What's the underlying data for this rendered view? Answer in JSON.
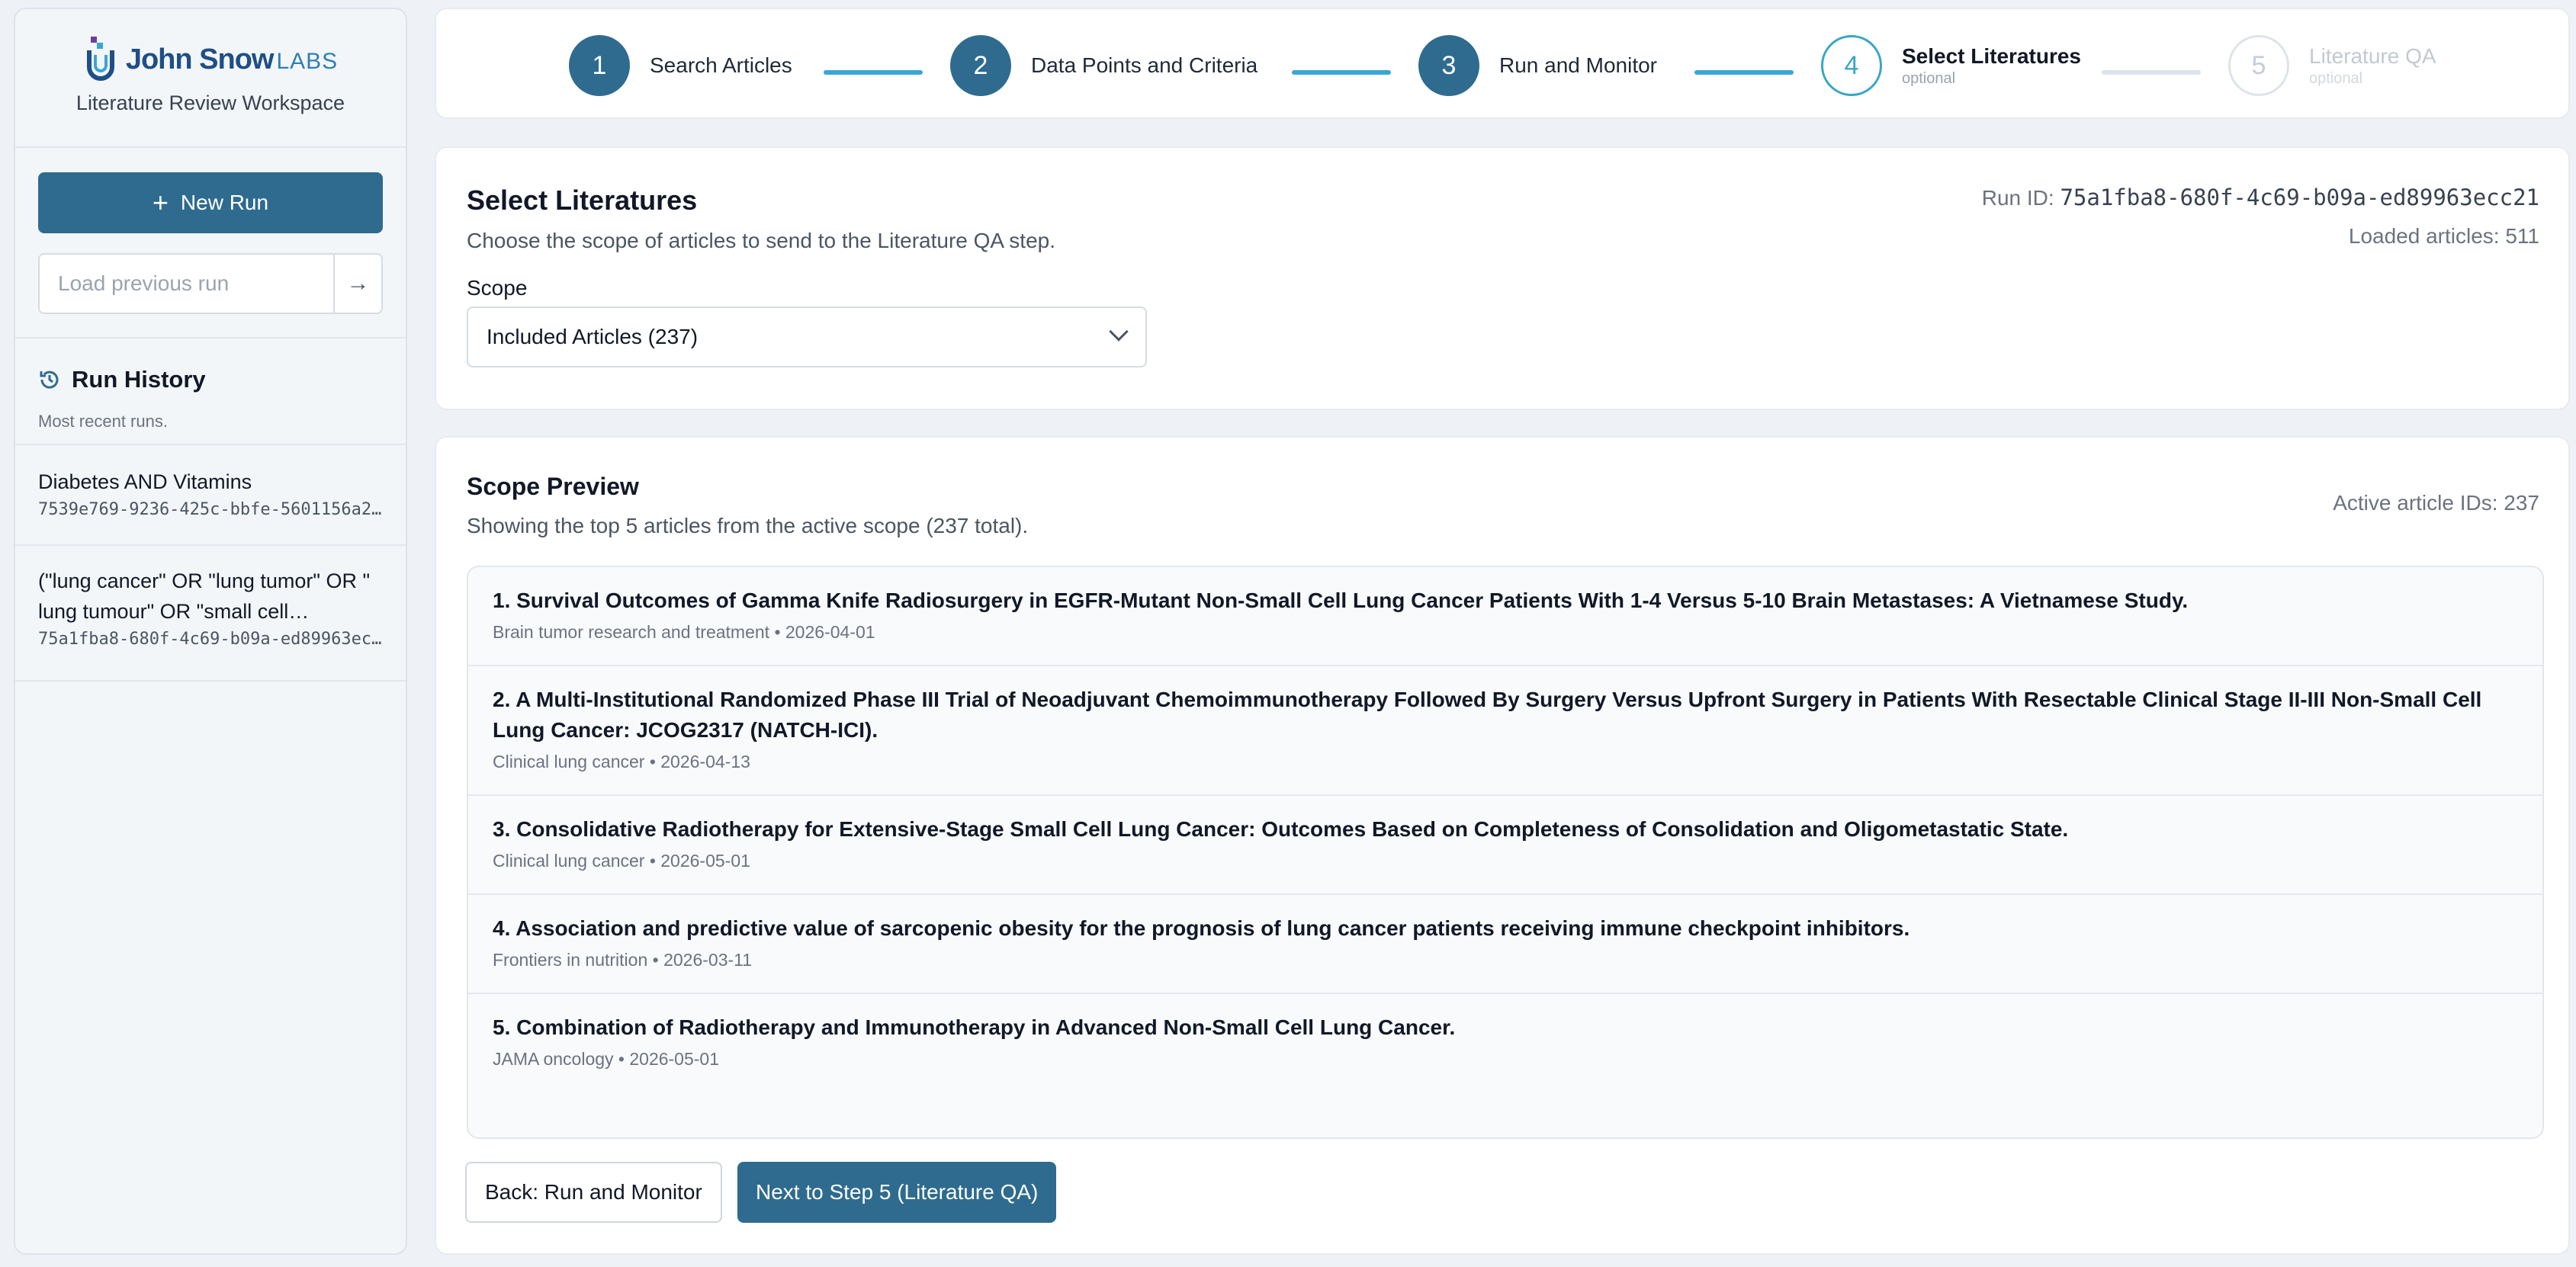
{
  "sidebar": {
    "brand": {
      "name": "John Snow",
      "labs": "LABS",
      "workspace": "Literature Review Workspace"
    },
    "new_run_label": "New Run",
    "load_placeholder": "Load previous run",
    "history": {
      "title": "Run History",
      "subtitle": "Most recent runs.",
      "items": [
        {
          "name": "Diabetes AND Vitamins",
          "id": "7539e769-9236-425c-bbfe-5601156a2…"
        },
        {
          "name": "(\"lung cancer\" OR \"lung tumor\" OR \" lung tumour\" OR \"small cell…",
          "id": "75a1fba8-680f-4c69-b09a-ed89963ec…"
        }
      ]
    }
  },
  "stepper": {
    "steps": [
      {
        "num": "1",
        "label": "Search Articles",
        "optional": ""
      },
      {
        "num": "2",
        "label": "Data Points and Criteria",
        "optional": ""
      },
      {
        "num": "3",
        "label": "Run and Monitor",
        "optional": ""
      },
      {
        "num": "4",
        "label": "Select Literatures",
        "optional": "optional"
      },
      {
        "num": "5",
        "label": "Literature QA",
        "optional": "optional"
      }
    ]
  },
  "select": {
    "title": "Select Literatures",
    "subtitle": "Choose the scope of articles to send to the Literature QA step.",
    "run_id_label": "Run ID:",
    "run_id": "75a1fba8-680f-4c69-b09a-ed89963ecc21",
    "loaded": "Loaded articles: 511",
    "scope_label": "Scope",
    "scope_value": "Included Articles (237)"
  },
  "preview": {
    "title": "Scope Preview",
    "subtitle": "Showing the top 5 articles from the active scope (237 total).",
    "active_ids": "Active article IDs: 237",
    "articles": [
      {
        "title": "1. Survival Outcomes of Gamma Knife Radiosurgery in EGFR-Mutant Non-Small Cell Lung Cancer Patients With 1-4 Versus 5-10 Brain Metastases: A Vietnamese Study.",
        "meta": "Brain tumor research and treatment • 2026-04-01"
      },
      {
        "title": "2. A Multi-Institutional Randomized Phase III Trial of Neoadjuvant Chemoimmunotherapy Followed By Surgery Versus Upfront Surgery in Patients With Resectable Clinical Stage II-III Non-Small Cell Lung Cancer: JCOG2317 (NATCH-ICI).",
        "meta": "Clinical lung cancer • 2026-04-13"
      },
      {
        "title": "3. Consolidative Radiotherapy for Extensive-Stage Small Cell Lung Cancer: Outcomes Based on Completeness of Consolidation and Oligometastatic State.",
        "meta": "Clinical lung cancer • 2026-05-01"
      },
      {
        "title": "4. Association and predictive value of sarcopenic obesity for the prognosis of lung cancer patients receiving immune checkpoint inhibitors.",
        "meta": "Frontiers in nutrition • 2026-03-11"
      },
      {
        "title": "5. Combination of Radiotherapy and Immunotherapy in Advanced Non-Small Cell Lung Cancer.",
        "meta": "JAMA oncology • 2026-05-01"
      }
    ],
    "back_label": "Back: Run and Monitor",
    "next_label": "Next to Step 5 (Literature QA)"
  }
}
